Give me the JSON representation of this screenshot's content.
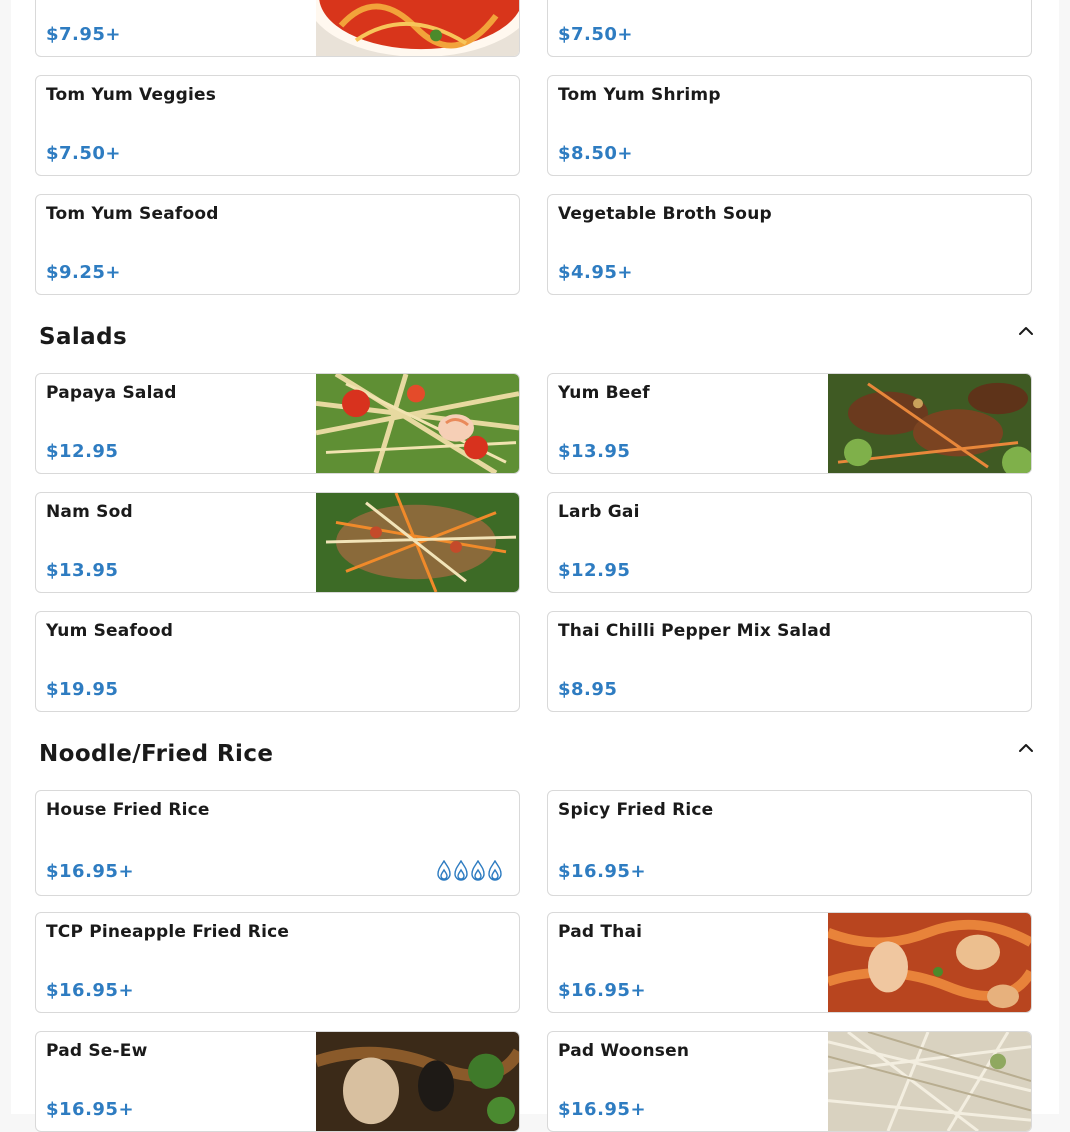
{
  "soups": {
    "items": [
      {
        "name": "",
        "price": "$7.95+",
        "image": "tom-yum-soup-photo"
      },
      {
        "name": "",
        "price": "$7.50+"
      },
      {
        "name": "Tom Yum Veggies",
        "price": "$7.50+"
      },
      {
        "name": "Tom Yum Shrimp",
        "price": "$8.50+"
      },
      {
        "name": "Tom Yum Seafood",
        "price": "$9.25+"
      },
      {
        "name": "Vegetable Broth Soup",
        "price": "$4.95+"
      }
    ]
  },
  "salads": {
    "title": "Salads",
    "items": [
      {
        "name": "Papaya Salad",
        "price": "$12.95",
        "image": "papaya-salad-photo"
      },
      {
        "name": "Yum Beef",
        "price": "$13.95",
        "image": "yum-beef-photo"
      },
      {
        "name": "Nam Sod",
        "price": "$13.95",
        "image": "nam-sod-photo"
      },
      {
        "name": "Larb Gai",
        "price": "$12.95"
      },
      {
        "name": "Yum Seafood",
        "price": "$19.95"
      },
      {
        "name": "Thai Chilli Pepper Mix Salad",
        "price": "$8.95"
      }
    ]
  },
  "noodles": {
    "title": "Noodle/Fried Rice",
    "items": [
      {
        "name": "House Fried Rice",
        "price": "$16.95+",
        "spice_level": 4
      },
      {
        "name": "Spicy Fried Rice",
        "price": "$16.95+"
      },
      {
        "name": "TCP Pineapple Fried Rice",
        "price": "$16.95+"
      },
      {
        "name": "Pad Thai",
        "price": "$16.95+",
        "image": "pad-thai-photo"
      },
      {
        "name": "Pad Se-Ew",
        "price": "$16.95+",
        "image": "pad-se-ew-photo"
      },
      {
        "name": "Pad Woonsen",
        "price": "$16.95+",
        "image": "pad-woonsen-photo"
      }
    ]
  },
  "colors": {
    "price": "#2e7cc1",
    "spice": "#2e7cc1",
    "border": "#d9d9d9"
  },
  "icons": {
    "collapse": "chevron-up-icon",
    "spice": "flame-icon"
  }
}
